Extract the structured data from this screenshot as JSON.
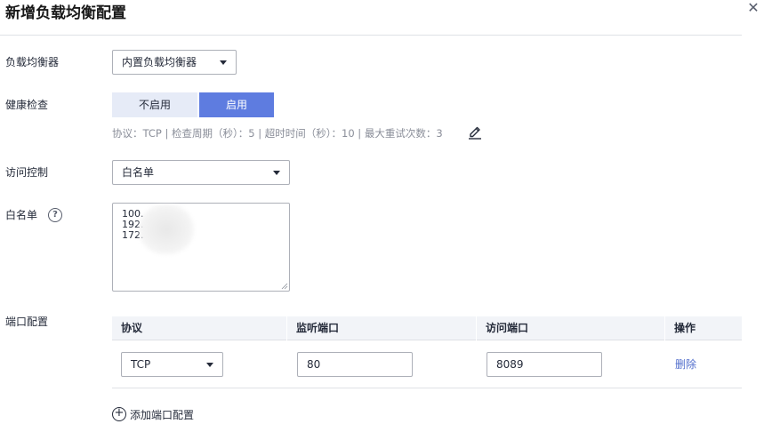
{
  "dialog": {
    "title": "新增负载均衡配置",
    "close_icon": "close-icon"
  },
  "load_balancer": {
    "label": "负载均衡器",
    "selected": "内置负载均衡器"
  },
  "health_check": {
    "label": "健康检查",
    "off_label": "不启用",
    "on_label": "启用",
    "active": "启用",
    "info": "协议：TCP | 检查周期（秒）：5 | 超时时间（秒）：10 | 最大重试次数：3",
    "edit_icon": "pencil-icon"
  },
  "access_control": {
    "label": "访问控制",
    "selected": "白名单"
  },
  "whitelist": {
    "label": "白名单",
    "help_icon": "question-circle-icon",
    "lines": [
      "100.",
      "192.",
      "172."
    ]
  },
  "port_config": {
    "label": "端口配置",
    "columns": [
      "协议",
      "监听端口",
      "访问端口",
      "操作"
    ],
    "rows": [
      {
        "protocol": "TCP",
        "listen_port": "80",
        "access_port": "8089",
        "action": "删除"
      }
    ],
    "add_label": "添加端口配置",
    "add_icon": "plus-circle-icon"
  },
  "colors": {
    "accent": "#5e7ce0",
    "link": "#526ecc",
    "toggle_inactive_bg": "#e6ebf7",
    "table_header_bg": "#f2f4f8"
  }
}
